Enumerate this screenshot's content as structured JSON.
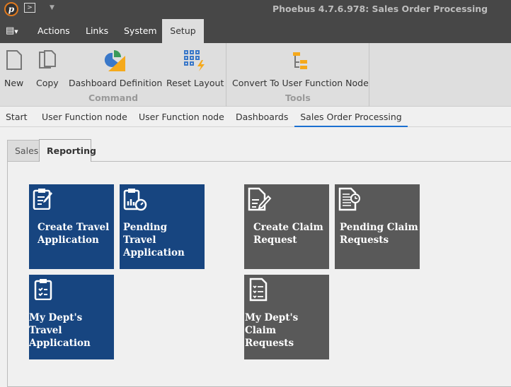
{
  "window": {
    "title": "Phoebus 4.7.6.978: Sales Order Processing",
    "logo_letter": "p",
    "terminal_icon": ">"
  },
  "menu": [
    "Actions",
    "Links",
    "System",
    "Setup"
  ],
  "ribbon": {
    "command": {
      "label": "Command",
      "buttons": [
        "New",
        "Copy",
        "Dashboard Definition",
        "Reset Layout"
      ]
    },
    "tools": {
      "label": "Tools",
      "buttons": [
        "Convert To User Function Node"
      ]
    }
  },
  "doc_tabs": [
    "Start",
    "User Function node",
    "User Function node",
    "Dashboards",
    "Sales Order Processing"
  ],
  "inner_tabs": [
    "Sales",
    "Reporting"
  ],
  "tiles": [
    {
      "label": "Create Travel Application",
      "color": "#174580"
    },
    {
      "label": "Pending Travel Application",
      "color": "#174580"
    },
    {
      "label": "My Dept's Travel Application",
      "color": "#174580"
    },
    {
      "label": "Create Claim Request",
      "color": "#595959"
    },
    {
      "label": "Pending Claim Requests",
      "color": "#595959"
    },
    {
      "label": "My Dept's Claim Requests",
      "color": "#595959"
    }
  ]
}
